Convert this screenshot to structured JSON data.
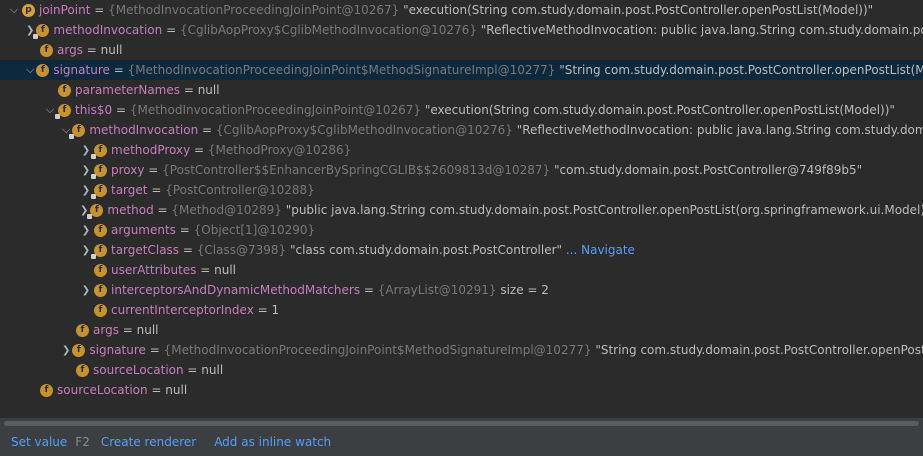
{
  "tree": {
    "rows": [
      {
        "depth": 0,
        "arrow": "v",
        "badge": "p",
        "lock": false,
        "name": "joinPoint",
        "ref": "{MethodInvocationProceedingJoinPoint@10267}",
        "value": "\"execution(String com.study.domain.post.PostController.openPostList(Model))\"",
        "selected": false
      },
      {
        "depth": 1,
        "arrow": ">",
        "badge": "f",
        "lock": true,
        "name": "methodInvocation",
        "ref": "{CglibAopProxy$CglibMethodInvocation@10276}",
        "value": "\"ReflectiveMethodInvocation: public java.lang.String com.study.domain.post.PostControll",
        "selected": false
      },
      {
        "depth": 1,
        "arrow": "",
        "badge": "f",
        "lock": false,
        "name": "args",
        "ref": "",
        "value": "null",
        "selected": false
      },
      {
        "depth": 1,
        "arrow": "v",
        "badge": "f",
        "lock": false,
        "name": "signature",
        "ref": "{MethodInvocationProceedingJoinPoint$MethodSignatureImpl@10277}",
        "value": "\"String com.study.domain.post.PostController.openPostList(Model)\"",
        "selected": true
      },
      {
        "depth": 2,
        "arrow": "",
        "badge": "f",
        "lock": false,
        "name": "parameterNames",
        "ref": "",
        "value": "null",
        "selected": false
      },
      {
        "depth": 2,
        "arrow": "v",
        "badge": "f",
        "lock": true,
        "name": "this$0",
        "ref": "{MethodInvocationProceedingJoinPoint@10267}",
        "value": "\"execution(String com.study.domain.post.PostController.openPostList(Model))\"",
        "selected": false
      },
      {
        "depth": 3,
        "arrow": "v",
        "badge": "f",
        "lock": true,
        "name": "methodInvocation",
        "ref": "{CglibAopProxy$CglibMethodInvocation@10276}",
        "value": "\"ReflectiveMethodInvocation: public java.lang.String com.study.domain.post.PostCo",
        "selected": false
      },
      {
        "depth": 4,
        "arrow": ">",
        "badge": "f",
        "lock": true,
        "name": "methodProxy",
        "ref": "{MethodProxy@10286}",
        "value": "",
        "selected": false
      },
      {
        "depth": 4,
        "arrow": ">",
        "badge": "f",
        "lock": true,
        "name": "proxy",
        "ref": "{PostController$$EnhancerBySpringCGLIB$$2609813d@10287}",
        "value": "\"com.study.domain.post.PostController@749f89b5\"",
        "selected": false
      },
      {
        "depth": 4,
        "arrow": ">",
        "badge": "f",
        "lock": true,
        "name": "target",
        "ref": "{PostController@10288}",
        "value": "",
        "selected": false
      },
      {
        "depth": 4,
        "arrow": ">",
        "badge": "f",
        "lock": true,
        "name": "method",
        "ref": "{Method@10289}",
        "value": "\"public java.lang.String com.study.domain.post.PostController.openPostList(org.springframework.ui.Model)\"",
        "selected": false
      },
      {
        "depth": 4,
        "arrow": ">",
        "badge": "f",
        "lock": false,
        "name": "arguments",
        "ref": "{Object[1]@10290}",
        "value": "",
        "selected": false
      },
      {
        "depth": 4,
        "arrow": ">",
        "badge": "f",
        "lock": true,
        "name": "targetClass",
        "ref": "{Class@7398}",
        "value": "\"class com.study.domain.post.PostController\"",
        "link": "... Navigate",
        "selected": false
      },
      {
        "depth": 4,
        "arrow": "",
        "badge": "f",
        "lock": false,
        "name": "userAttributes",
        "ref": "",
        "value": "null",
        "selected": false
      },
      {
        "depth": 4,
        "arrow": ">",
        "badge": "f",
        "lock": false,
        "name": "interceptorsAndDynamicMethodMatchers",
        "ref": "{ArrayList@10291}",
        "value": " size = 2",
        "selected": false
      },
      {
        "depth": 4,
        "arrow": "",
        "badge": "f",
        "lock": false,
        "name": "currentInterceptorIndex",
        "ref": "",
        "value": "1",
        "selected": false
      },
      {
        "depth": 3,
        "arrow": "",
        "badge": "f",
        "lock": false,
        "name": "args",
        "ref": "",
        "value": "null",
        "selected": false
      },
      {
        "depth": 3,
        "arrow": ">",
        "badge": "f",
        "lock": false,
        "name": "signature",
        "ref": "{MethodInvocationProceedingJoinPoint$MethodSignatureImpl@10277}",
        "value": "\"String com.study.domain.post.PostController.openPostList(Model)\"",
        "selected": false
      },
      {
        "depth": 3,
        "arrow": "",
        "badge": "f",
        "lock": false,
        "name": "sourceLocation",
        "ref": "",
        "value": "null",
        "selected": false
      },
      {
        "depth": 1,
        "arrow": "",
        "badge": "f",
        "lock": false,
        "name": "sourceLocation",
        "ref": "",
        "value": "null",
        "selected": false
      }
    ]
  },
  "footer": {
    "set_value": "Set value",
    "set_value_key": "F2",
    "create_renderer": "Create renderer",
    "add_inline_watch": "Add as inline watch"
  },
  "colors": {
    "background": "#2b2b2b",
    "selected_row": "#0d293e",
    "field_name": "#c77dbb",
    "object_ref": "#787878",
    "link": "#589df6",
    "badge": "#c7922d"
  }
}
